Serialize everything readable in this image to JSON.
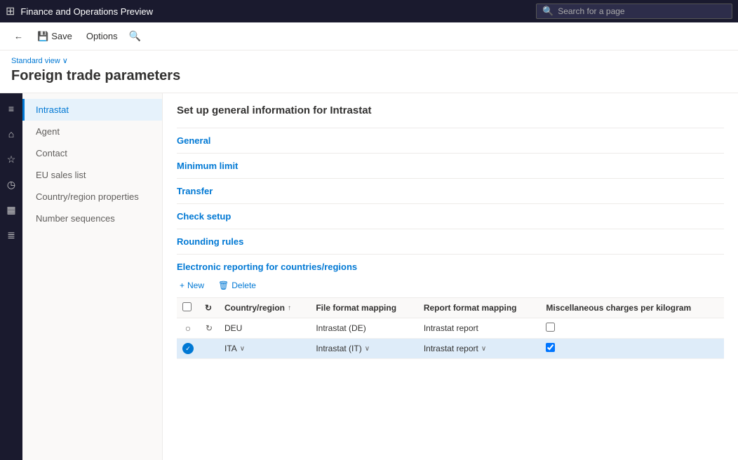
{
  "app": {
    "title": "Finance and Operations Preview",
    "search_placeholder": "Search for a page"
  },
  "command_bar": {
    "back_label": "",
    "save_label": "Save",
    "options_label": "Options"
  },
  "page": {
    "view_label": "Standard view",
    "title": "Foreign trade parameters"
  },
  "nav_sidebar": {
    "items": [
      {
        "id": "intrastat",
        "label": "Intrastat",
        "active": true
      },
      {
        "id": "agent",
        "label": "Agent",
        "active": false
      },
      {
        "id": "contact",
        "label": "Contact",
        "active": false
      },
      {
        "id": "eu-sales-list",
        "label": "EU sales list",
        "active": false
      },
      {
        "id": "country-region-properties",
        "label": "Country/region properties",
        "active": false
      },
      {
        "id": "number-sequences",
        "label": "Number sequences",
        "active": false
      }
    ]
  },
  "content": {
    "section_header": "Set up general information for Intrastat",
    "sections": [
      {
        "id": "general",
        "label": "General"
      },
      {
        "id": "minimum-limit",
        "label": "Minimum limit"
      },
      {
        "id": "transfer",
        "label": "Transfer"
      },
      {
        "id": "check-setup",
        "label": "Check setup"
      },
      {
        "id": "rounding-rules",
        "label": "Rounding rules"
      }
    ],
    "er_section": {
      "title": "Electronic reporting for countries/regions",
      "toolbar": {
        "new_label": "New",
        "delete_label": "Delete"
      },
      "table": {
        "columns": [
          {
            "id": "select",
            "label": ""
          },
          {
            "id": "refresh",
            "label": ""
          },
          {
            "id": "country_region",
            "label": "Country/region",
            "sortable": true
          },
          {
            "id": "file_format_mapping",
            "label": "File format mapping"
          },
          {
            "id": "report_format_mapping",
            "label": "Report format mapping"
          },
          {
            "id": "misc_charges",
            "label": "Miscellaneous charges per kilogram"
          }
        ],
        "rows": [
          {
            "id": "row1",
            "selected": false,
            "country_region": "DEU",
            "file_format_mapping": "Intrastat (DE)",
            "report_format_mapping": "Intrastat report",
            "misc_charges_checked": false
          },
          {
            "id": "row2",
            "selected": true,
            "country_region": "ITA",
            "file_format_mapping": "Intrastat (IT)",
            "report_format_mapping": "Intrastat report",
            "misc_charges_checked": true
          }
        ]
      }
    }
  },
  "icons": {
    "grid": "⊞",
    "back": "←",
    "save": "💾",
    "search": "🔍",
    "chevron_down": "∨",
    "plus": "+",
    "delete": "🗑",
    "sort_up": "↑",
    "radio_unchecked": "○",
    "refresh": "↻",
    "check": "✓"
  },
  "left_icons": [
    "≡",
    "⌂",
    "☆",
    "◷",
    "▦",
    "≣"
  ]
}
